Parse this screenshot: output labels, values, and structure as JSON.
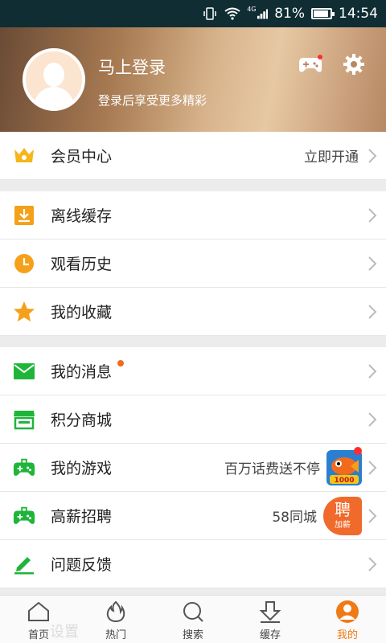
{
  "status_bar": {
    "network": "4G",
    "battery": "81%",
    "time": "14:54"
  },
  "profile": {
    "title": "马上登录",
    "subtitle": "登录后享受更多精彩"
  },
  "colors": {
    "accent": "#f07a16",
    "green": "#1fb53a",
    "orange": "#f5a01a"
  },
  "sections": [
    [
      {
        "label": "会员中心",
        "right": "立即开通",
        "icon": "vip-crown-icon"
      }
    ],
    [
      {
        "label": "离线缓存",
        "icon": "download-box-icon"
      },
      {
        "label": "观看历史",
        "icon": "clock-icon"
      },
      {
        "label": "我的收藏",
        "icon": "star-icon"
      }
    ],
    [
      {
        "label": "我的消息",
        "icon": "mail-icon"
      },
      {
        "label": "积分商城",
        "icon": "store-icon"
      },
      {
        "label": "我的游戏",
        "right": "百万话费送不停",
        "icon": "gamepad-icon"
      },
      {
        "label": "高薪招聘",
        "right": "58同城",
        "icon": "gamepad-icon"
      },
      {
        "label": "问题反馈",
        "icon": "pencil-icon"
      }
    ]
  ],
  "recruit_badge": {
    "big": "聘",
    "small": "加薪"
  },
  "game_badge": {
    "text": "1000"
  },
  "tabs": [
    {
      "label": "首页",
      "icon": "home-icon"
    },
    {
      "label": "热门",
      "icon": "flame-icon"
    },
    {
      "label": "搜索",
      "icon": "search-icon"
    },
    {
      "label": "缓存",
      "icon": "download-icon"
    },
    {
      "label": "我的",
      "icon": "user-icon"
    }
  ],
  "ghost": "设置"
}
